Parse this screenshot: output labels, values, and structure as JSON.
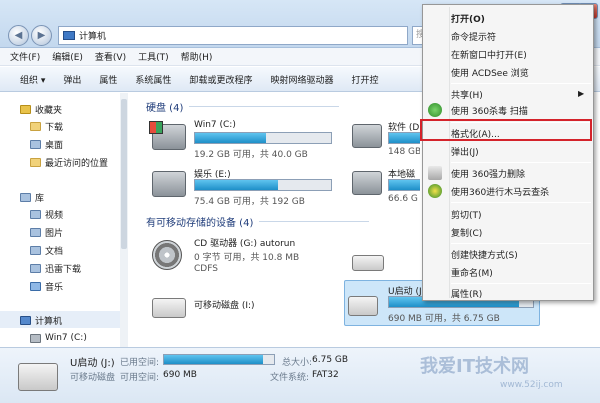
{
  "address": {
    "path": "计算机",
    "search_partial": "搜"
  },
  "menubar": [
    "文件(F)",
    "编辑(E)",
    "查看(V)",
    "工具(T)",
    "帮助(H)"
  ],
  "toolbar": [
    "组织 ▾",
    "弹出",
    "属性",
    "系统属性",
    "卸载或更改程序",
    "映射网络驱动器",
    "打开控"
  ],
  "nav": {
    "favorites": "收藏夹",
    "fav_items": [
      "下载",
      "桌面",
      "最近访问的位置"
    ],
    "libraries": "库",
    "lib_items": [
      "视频",
      "图片",
      "文档",
      "迅雷下载",
      "音乐"
    ],
    "computer": "计算机",
    "computer_items": [
      "Win7 (C:)"
    ]
  },
  "groups": {
    "hdd": "硬盘 (4)",
    "removable": "有可移动存储的设备 (4)"
  },
  "drives": [
    {
      "name": "Win7 (C:)",
      "sub": "19.2 GB 可用，共 40.0 GB",
      "used": 0.52
    },
    {
      "name": "娱乐 (E:)",
      "sub": "75.4 GB 可用，共 192 GB",
      "used": 0.61
    },
    {
      "name": "软件 (D",
      "sub": "148 GB",
      "used": 0.4
    },
    {
      "name": "本地磁",
      "sub": "66.6 G",
      "used": 0.55
    }
  ],
  "removable": [
    {
      "name": "CD 驱动器 (G:) autorun",
      "sub": "0 字节 可用，共 10.8 MB",
      "sub2": "CDFS"
    },
    {
      "name": "可移动磁盘 (I:)"
    },
    {
      "name": "U启动 (J:)",
      "sub": "690 MB 可用，共 6.75 GB",
      "used": 0.9
    }
  ],
  "status": {
    "name": "U启动 (J:)",
    "type": "可移动磁盘",
    "used_label": "已用空间:",
    "free_label": "可用空间:",
    "free": "690 MB",
    "total_label": "总大小:",
    "total": "6.75 GB",
    "fs_label": "文件系统:",
    "fs": "FAT32",
    "used": 0.9
  },
  "context_menu": {
    "items": [
      {
        "label": "打开(O)",
        "bold": true
      },
      {
        "label": "命令提示符"
      },
      {
        "label": "在新窗口中打开(E)"
      },
      {
        "label": "使用 ACDSee 浏览"
      },
      {
        "label": "共享(H)",
        "submenu": true
      },
      {
        "label": "使用 360杀毒 扫描"
      },
      {
        "label": "格式化(A)..."
      },
      {
        "label": "弹出(J)"
      },
      {
        "label": "使用 360强力删除"
      },
      {
        "label": "使用360进行木马云查杀"
      },
      {
        "label": "剪切(T)"
      },
      {
        "label": "复制(C)"
      },
      {
        "label": "创建快捷方式(S)"
      },
      {
        "label": "重命名(M)"
      },
      {
        "label": "属性(R)"
      }
    ]
  },
  "watermark": {
    "main": "我爱IT技术网",
    "url": "www.52ij.com"
  },
  "colors": {
    "highlight_box": "#d4232b",
    "bar_fill": "#1e8fc8",
    "selection": "#cde6f9"
  }
}
